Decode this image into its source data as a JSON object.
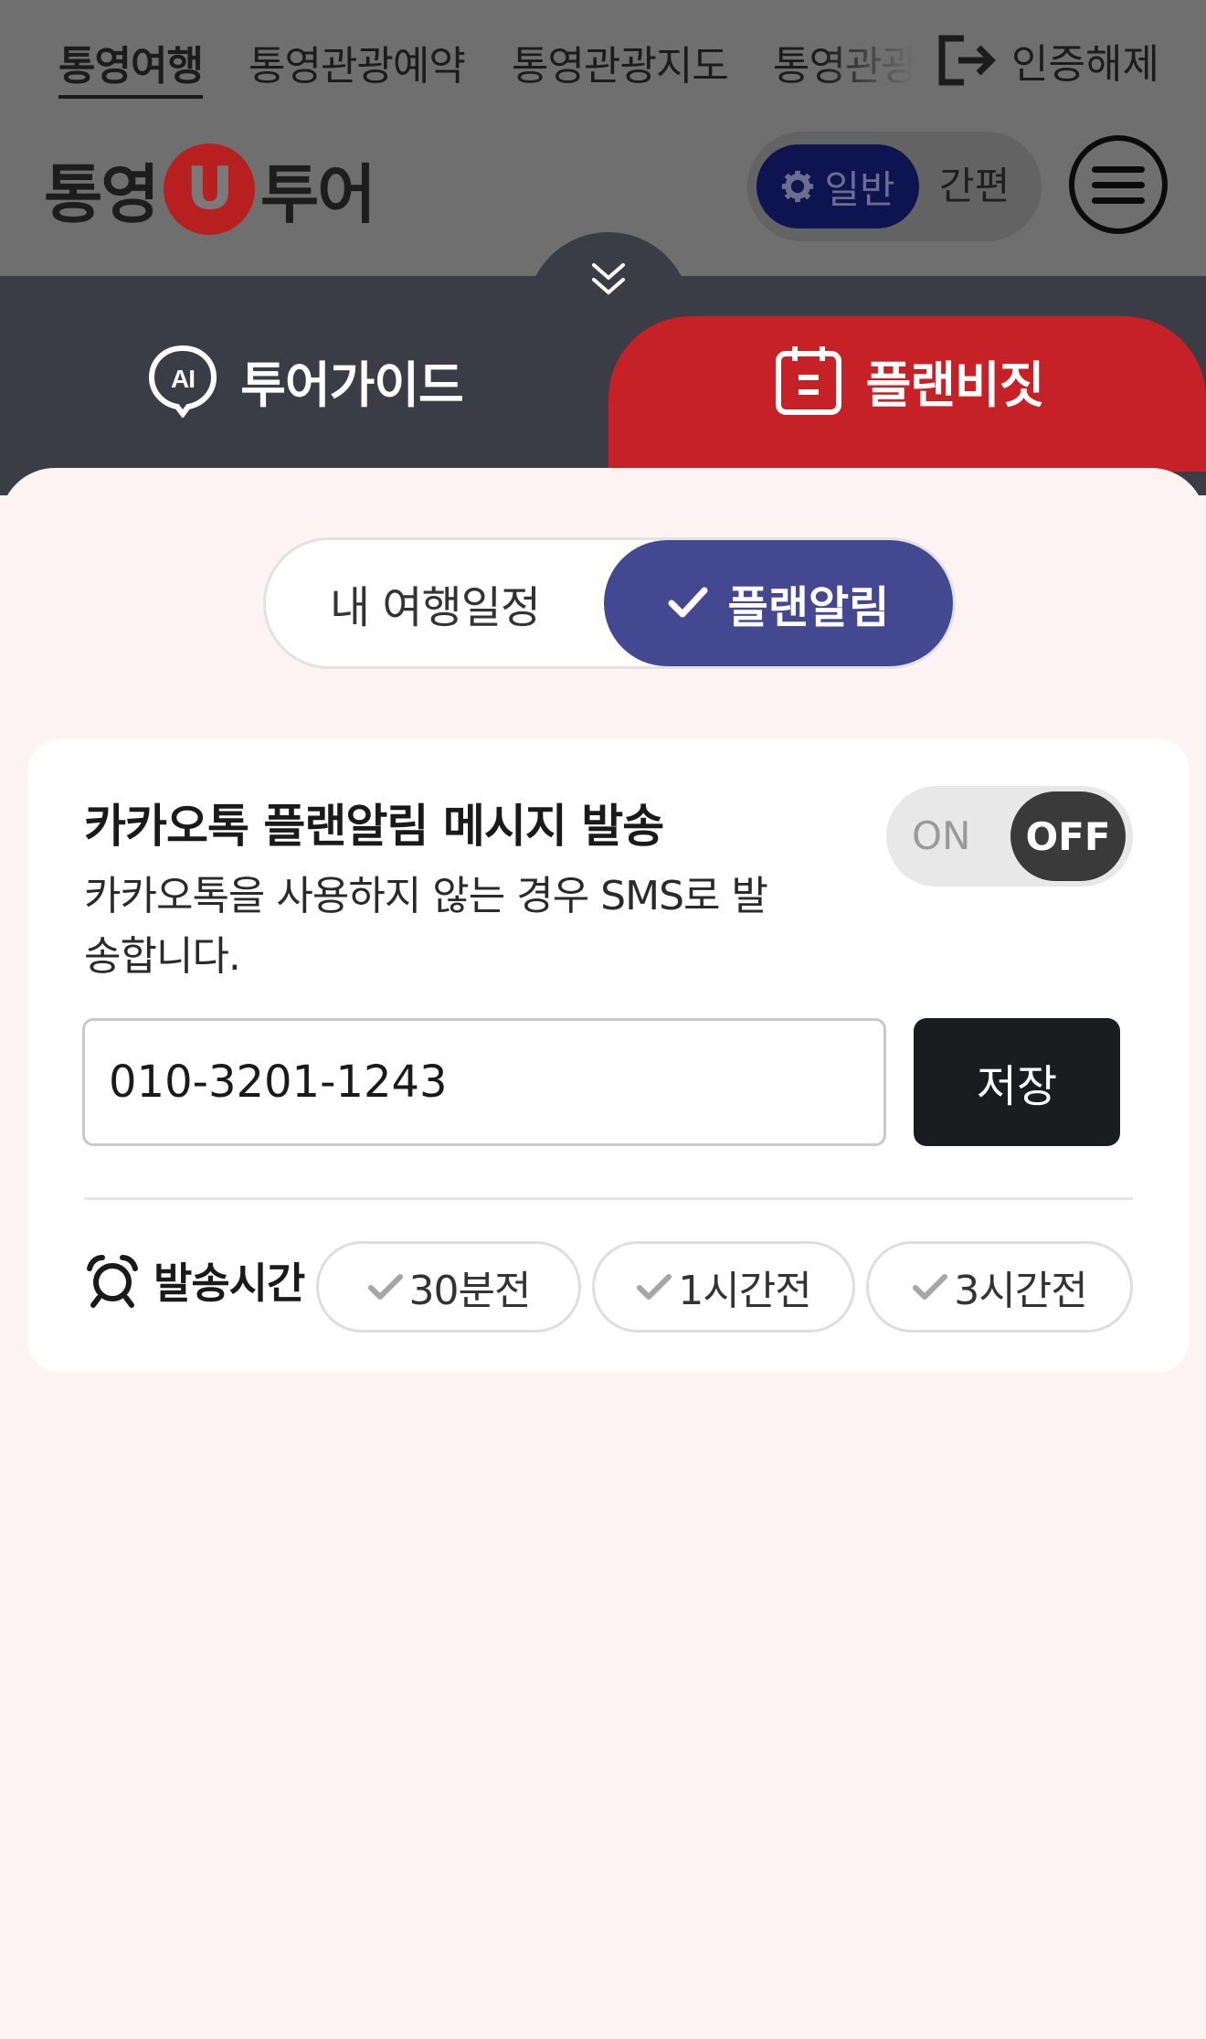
{
  "top_nav": {
    "items": [
      {
        "label": "통영여행",
        "active": true
      },
      {
        "label": "통영관광예약",
        "active": false
      },
      {
        "label": "통영관광지도",
        "active": false
      },
      {
        "label": "통영관광",
        "active": false
      }
    ],
    "logout_label": "인증해제",
    "logout_icon": "logout-icon"
  },
  "header": {
    "logo_left": "통영",
    "logo_mark": "U",
    "logo_right": "투어",
    "mode_general": "일반",
    "mode_simple": "간편",
    "menu_icon": "hamburger-icon"
  },
  "sheet": {
    "collapse_icon": "double-chevron-down-icon",
    "tabs": [
      {
        "label": "투어가이드",
        "icon": "ai-chat-icon",
        "active": false
      },
      {
        "label": "플랜비짓",
        "icon": "calendar-icon",
        "active": true
      }
    ],
    "segment": {
      "left_label": "내 여행일정",
      "right_label": "플랜알림",
      "selected": "플랜알림"
    }
  },
  "alert_card": {
    "title": "카카오톡 플랜알림 메시지 발송",
    "description": "카카오톡을 사용하지 않는 경우 SMS로 발송합니다.",
    "switch_on": "ON",
    "switch_off": "OFF",
    "switch_state": "OFF",
    "phone_value": "010-3201-1243",
    "save_label": "저장",
    "time_label": "발송시간",
    "time_icon": "alarm-clock-icon",
    "time_options": [
      "30분전",
      "1시간전",
      "3시간전"
    ]
  },
  "colors": {
    "accent_red": "#c62127",
    "segment_active": "#434890",
    "sheet_header": "#3a3d45",
    "sheet_background": "#fdf3f3",
    "save_button": "#1a1c1f"
  }
}
